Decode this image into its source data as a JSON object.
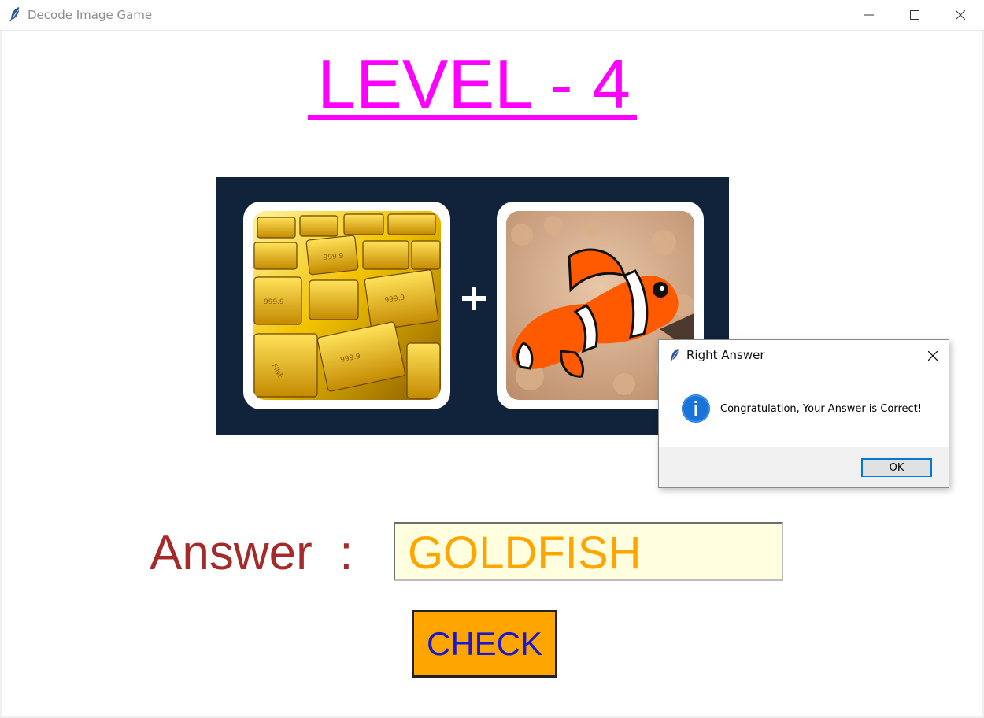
{
  "window": {
    "title": "Decode Image Game",
    "app_icon": "feather-icon",
    "controls": [
      "minimize-icon",
      "maximize-icon",
      "close-icon"
    ]
  },
  "game": {
    "level_title": "LEVEL - 4",
    "level_color": "#ff00ff",
    "puzzle": {
      "background_color": "#10233a",
      "left_image": "gold-bars-image",
      "operator_icon": "plus-icon",
      "right_image": "clownfish-image"
    },
    "answer_label": "Answer  :",
    "answer_value": "GOLDFISH",
    "check_label": "CHECK",
    "colors": {
      "answer_label": "#a52a2a",
      "answer_text": "#ffa500",
      "answer_bg": "#ffffe0",
      "check_bg": "#ffa500",
      "check_text": "#1717d4"
    }
  },
  "dialog": {
    "title": "Right Answer",
    "icon": "info-icon",
    "message": "Congratulation, Your Answer is Correct!",
    "ok_label": "OK"
  }
}
